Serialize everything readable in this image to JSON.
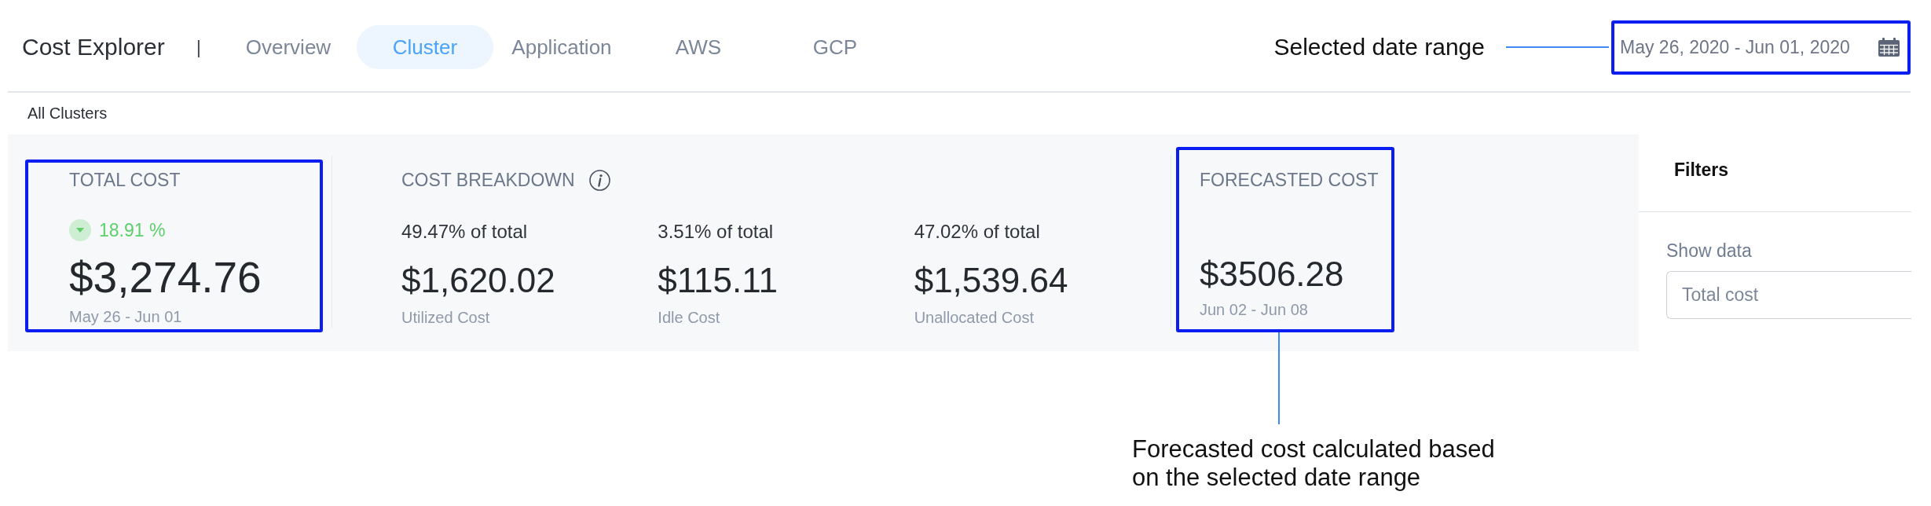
{
  "header": {
    "title": "Cost Explorer",
    "separator": "|",
    "tabs": [
      {
        "label": "Overview",
        "selected": false
      },
      {
        "label": "Cluster",
        "selected": true
      },
      {
        "label": "Application",
        "selected": false
      },
      {
        "label": "AWS",
        "selected": false
      },
      {
        "label": "GCP",
        "selected": false
      }
    ],
    "date_range": {
      "value": "May 26, 2020 - Jun 01, 2020",
      "highlighted": true,
      "annotation": "Selected date range"
    }
  },
  "breadcrumb": "All Clusters",
  "summary": {
    "total_cost": {
      "title": "TOTAL COST",
      "decreased": true,
      "change": "18.91 %",
      "amount": "$3,274.76",
      "period": "May 26 - Jun 01",
      "highlighted": true
    },
    "breakdown": {
      "title": "COST BREAKDOWN",
      "items": [
        {
          "share": "49.47% of total",
          "amount": "$1,620.02",
          "label": "Utilized Cost"
        },
        {
          "share": "3.51% of total",
          "amount": "$115.11",
          "label": "Idle Cost"
        },
        {
          "share": "47.02% of total",
          "amount": "$1,539.64",
          "label": "Unallocated Cost"
        }
      ]
    },
    "forecast": {
      "title": "FORECASTED COST",
      "amount": "$3506.28",
      "period": "Jun 02 - Jun 08",
      "highlighted": true,
      "annotation": "Forecasted cost calculated based on the selected date range"
    }
  },
  "filters": {
    "title": "Filters",
    "fields": [
      {
        "label": "Show data",
        "value": "Total cost"
      }
    ]
  }
}
